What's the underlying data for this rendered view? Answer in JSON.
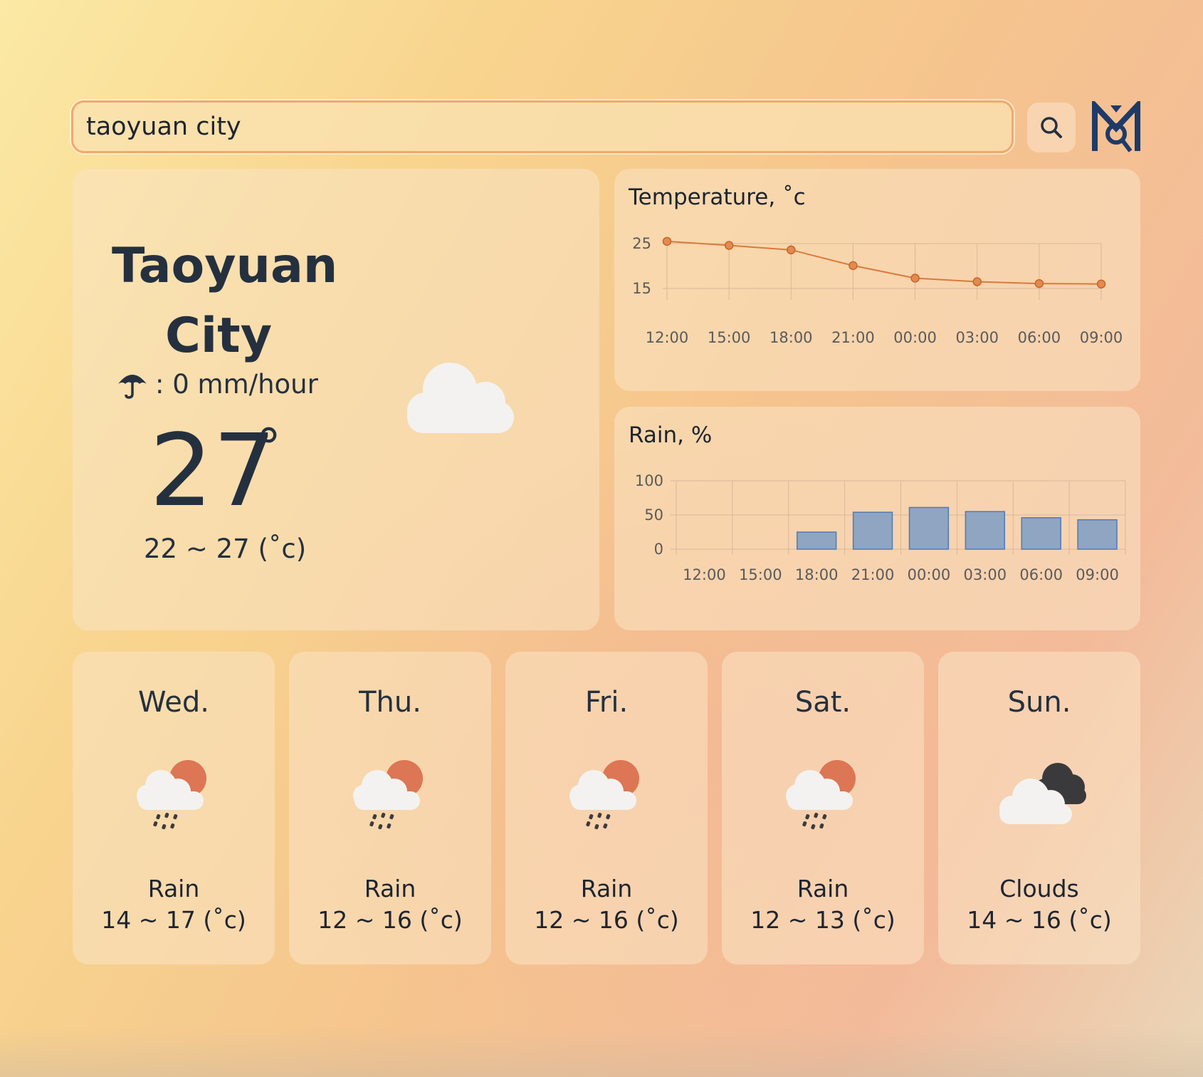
{
  "search": {
    "value": "taoyuan city",
    "button_icon": "search-icon"
  },
  "logo": {
    "icon": "brand-logo"
  },
  "current": {
    "city": "Taoyuan City",
    "precip_icon": "umbrella-icon",
    "precip_text": ": 0 mm/hour",
    "temp": "27",
    "deg": "°",
    "range": "22 ~ 27 (˚c)",
    "condition_icon": "cloud-icon"
  },
  "chart_data": [
    {
      "type": "line",
      "title": "Temperature, ˚c",
      "x": [
        "12:00",
        "15:00",
        "18:00",
        "21:00",
        "00:00",
        "03:00",
        "06:00",
        "09:00"
      ],
      "series": [
        {
          "values": [
            25.5,
            24.6,
            23.6,
            20.1,
            17.3,
            16.5,
            16.1,
            16.0
          ]
        }
      ],
      "yticks": [
        "25",
        "15"
      ],
      "ylim": [
        15,
        25
      ],
      "grid": true,
      "color": "#d97a3d"
    },
    {
      "type": "bar",
      "title": "Rain, %",
      "categories": [
        "12:00",
        "15:00",
        "18:00",
        "21:00",
        "00:00",
        "03:00",
        "06:00",
        "09:00"
      ],
      "values": [
        0,
        0,
        25,
        54,
        61,
        55,
        46,
        43
      ],
      "yticks": [
        "100",
        "50",
        "0"
      ],
      "ylim": [
        0,
        100
      ],
      "grid": true,
      "color": "#8fa5c2"
    }
  ],
  "forecast": [
    {
      "day": "Wed.",
      "icon": "rain-sun-icon",
      "condition": "Rain",
      "range": "14 ~ 17 (˚c)"
    },
    {
      "day": "Thu.",
      "icon": "rain-sun-icon",
      "condition": "Rain",
      "range": "12 ~ 16 (˚c)"
    },
    {
      "day": "Fri.",
      "icon": "rain-sun-icon",
      "condition": "Rain",
      "range": "12 ~ 16 (˚c)"
    },
    {
      "day": "Sat.",
      "icon": "rain-sun-icon",
      "condition": "Rain",
      "range": "12 ~ 13 (˚c)"
    },
    {
      "day": "Sun.",
      "icon": "clouds-icon",
      "condition": "Clouds",
      "range": "14 ~ 16 (˚c)"
    }
  ]
}
